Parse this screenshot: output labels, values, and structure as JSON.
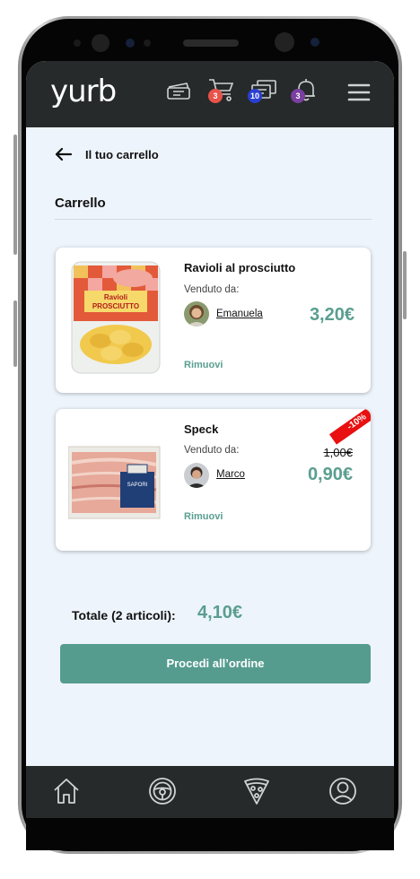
{
  "app": {
    "logo_text": "yurb",
    "brand_color": "#5a9e90",
    "topbar_color": "#262a2a"
  },
  "topbar": {
    "icons": [
      {
        "name": "ticket-icon"
      },
      {
        "name": "cart-icon",
        "badge": "3",
        "badge_color": "#e8534a"
      },
      {
        "name": "messages-icon",
        "badge": "10",
        "badge_color": "#2a3fd1"
      },
      {
        "name": "bell-icon",
        "badge": "3",
        "badge_color": "#7a3fa0"
      },
      {
        "name": "menu-icon"
      }
    ]
  },
  "page": {
    "back_title": "Il tuo carrello",
    "section_title": "Carrello"
  },
  "cart": {
    "items": [
      {
        "name": "Ravioli al prosciutto",
        "sold_by_label": "Venduto da:",
        "seller": "Emanuela",
        "price": "3,20€",
        "remove_label": "Rimuovi"
      },
      {
        "name": "Speck",
        "sold_by_label": "Venduto da:",
        "seller": "Marco",
        "old_price": "1,00€",
        "price": "0,90€",
        "discount": "-10%",
        "remove_label": "Rimuovi"
      }
    ],
    "total_label": "Totale (2 articoli):",
    "total_value": "4,10€",
    "cta_label": "Procedi all’ordine"
  },
  "bottom_nav": [
    {
      "name": "home-icon"
    },
    {
      "name": "steering-wheel-icon"
    },
    {
      "name": "pizza-icon"
    },
    {
      "name": "profile-icon"
    }
  ]
}
